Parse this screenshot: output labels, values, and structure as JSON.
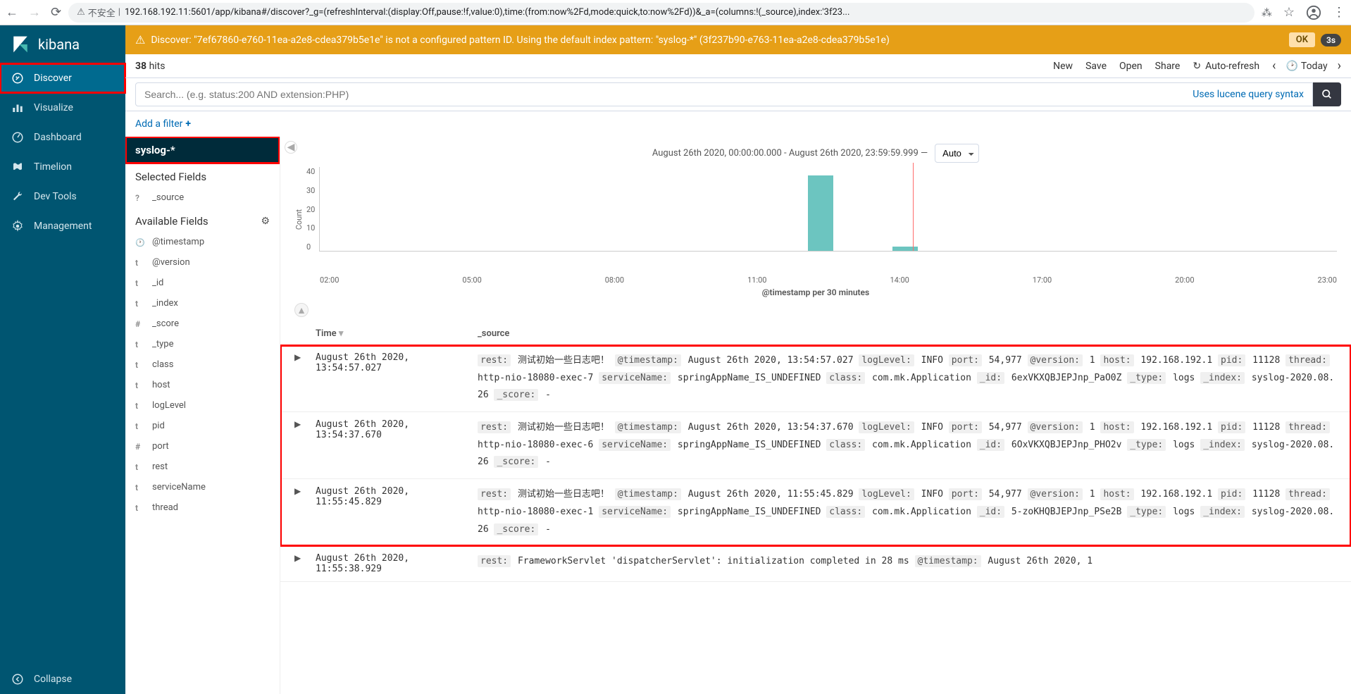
{
  "browser": {
    "insecure_label": "不安全",
    "url": "192.168.192.11:5601/app/kibana#/discover?_g=(refreshInterval:(display:Off,pause:!f,value:0),time:(from:now%2Fd,mode:quick,to:now%2Fd))&_a=(columns:!(_source),index:'3f23..."
  },
  "sidebar": {
    "brand": "kibana",
    "items": [
      {
        "label": "Discover"
      },
      {
        "label": "Visualize"
      },
      {
        "label": "Dashboard"
      },
      {
        "label": "Timelion"
      },
      {
        "label": "Dev Tools"
      },
      {
        "label": "Management"
      }
    ],
    "collapse_label": "Collapse"
  },
  "banner": {
    "text": "Discover: \"7ef67860-e760-11ea-a2e8-cdea379b5e1e\" is not a configured pattern ID. Using the default index pattern: \"syslog-*\" (3f237b90-e763-11ea-a2e8-cdea379b5e1e)",
    "ok": "OK",
    "timer": "3s"
  },
  "topbar": {
    "hits_count": "38",
    "hits_label": "hits",
    "new": "New",
    "save": "Save",
    "open": "Open",
    "share": "Share",
    "autorefresh": "Auto-refresh",
    "today": "Today"
  },
  "search": {
    "placeholder": "Search... (e.g. status:200 AND extension:PHP)",
    "lucene": "Uses lucene query syntax"
  },
  "filter": {
    "add": "Add a filter"
  },
  "fields": {
    "index_pattern": "syslog-*",
    "selected_title": "Selected Fields",
    "available_title": "Available Fields",
    "selected": [
      {
        "type": "?",
        "name": "_source"
      }
    ],
    "available": [
      {
        "type": "clock",
        "name": "@timestamp"
      },
      {
        "type": "t",
        "name": "@version"
      },
      {
        "type": "t",
        "name": "_id"
      },
      {
        "type": "t",
        "name": "_index"
      },
      {
        "type": "#",
        "name": "_score"
      },
      {
        "type": "t",
        "name": "_type"
      },
      {
        "type": "t",
        "name": "class"
      },
      {
        "type": "t",
        "name": "host"
      },
      {
        "type": "t",
        "name": "logLevel"
      },
      {
        "type": "t",
        "name": "pid"
      },
      {
        "type": "#",
        "name": "port"
      },
      {
        "type": "t",
        "name": "rest"
      },
      {
        "type": "t",
        "name": "serviceName"
      },
      {
        "type": "t",
        "name": "thread"
      }
    ]
  },
  "histogram": {
    "range_label": "August 26th 2020, 00:00:00.000 - August 26th 2020, 23:59:59.999 —",
    "interval": "Auto",
    "ylabel": "Count",
    "xlabel": "@timestamp per 30 minutes",
    "yticks": [
      "40",
      "30",
      "20",
      "10",
      "0"
    ],
    "xticks": [
      "02:00",
      "05:00",
      "08:00",
      "11:00",
      "14:00",
      "17:00",
      "20:00",
      "23:00"
    ]
  },
  "table": {
    "col_time": "Time",
    "col_source": "_source",
    "rows": [
      {
        "time": "August 26th 2020, 13:54:57.027",
        "rest": "测试初始一些日志吧！",
        "timestamp": "August 26th 2020, 13:54:57.027",
        "logLevel": "INFO",
        "port": "54,977",
        "version": "1",
        "host": "192.168.192.1",
        "pid": "11128",
        "thread": "http-nio-18080-exec-7",
        "serviceName": "springAppName_IS_UNDEFINED",
        "class": "com.mk.Application",
        "_id": "6exVKXQBJEPJnp_PaO0Z",
        "_type": "logs",
        "_index": "syslog-2020.08.26",
        "_score": "-"
      },
      {
        "time": "August 26th 2020, 13:54:37.670",
        "rest": "测试初始一些日志吧！",
        "timestamp": "August 26th 2020, 13:54:37.670",
        "logLevel": "INFO",
        "port": "54,977",
        "version": "1",
        "host": "192.168.192.1",
        "pid": "11128",
        "thread": "http-nio-18080-exec-6",
        "serviceName": "springAppName_IS_UNDEFINED",
        "class": "com.mk.Application",
        "_id": "6OxVKXQBJEPJnp_PHO2v",
        "_type": "logs",
        "_index": "syslog-2020.08.26",
        "_score": "-"
      },
      {
        "time": "August 26th 2020, 11:55:45.829",
        "rest": "测试初始一些日志吧！",
        "timestamp": "August 26th 2020, 11:55:45.829",
        "logLevel": "INFO",
        "port": "54,977",
        "version": "1",
        "host": "192.168.192.1",
        "pid": "11128",
        "thread": "http-nio-18080-exec-1",
        "serviceName": "springAppName_IS_UNDEFINED",
        "class": "com.mk.Application",
        "_id": "5-zoKHQBJEPJnp_PSe2B",
        "_type": "logs",
        "_index": "syslog-2020.08.26",
        "_score": "-"
      }
    ],
    "partial_row": {
      "time": "August 26th 2020, 11:55:38.929",
      "rest": "FrameworkServlet 'dispatcherServlet': initialization completed in 28 ms",
      "timestamp": "August 26th 2020, 1"
    }
  },
  "chart_data": {
    "type": "bar",
    "title": "@timestamp per 30 minutes",
    "xlabel": "@timestamp per 30 minutes",
    "ylabel": "Count",
    "ylim": [
      0,
      40
    ],
    "x_range": [
      "2020-08-26 00:00",
      "2020-08-26 23:59"
    ],
    "bars": [
      {
        "bucket": "2020-08-26 11:30",
        "count": 36
      },
      {
        "bucket": "2020-08-26 13:30",
        "count": 2
      }
    ],
    "current_time_marker": "2020-08-26 14:00"
  }
}
